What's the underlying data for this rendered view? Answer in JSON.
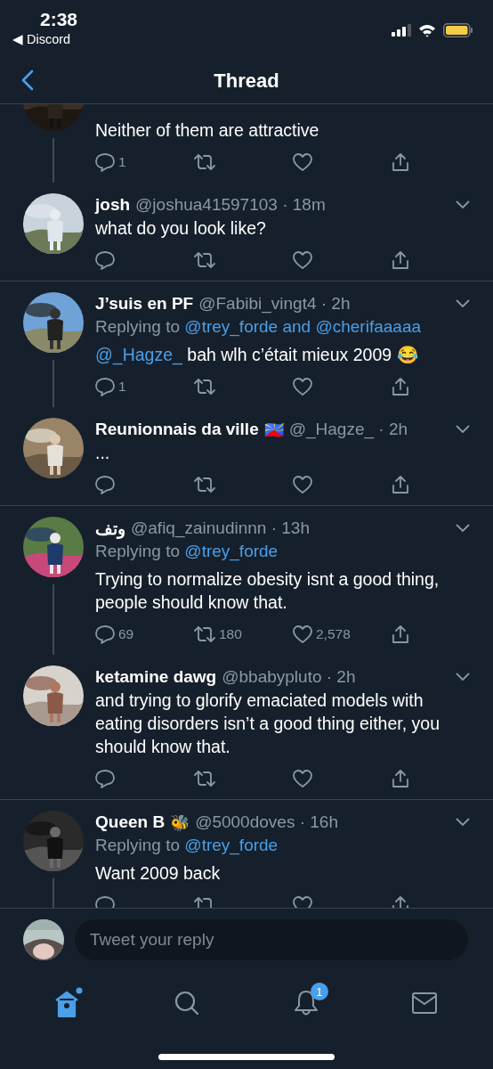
{
  "status_bar": {
    "time": "2:38",
    "back_app": "◀ Discord"
  },
  "header": {
    "title": "Thread"
  },
  "tweets": [
    {
      "text": "Neither of them are attractive",
      "replies": "1",
      "connected_below": true
    },
    {
      "name": "josh",
      "meta": "@joshua41597103 · 18m",
      "text": "what do you look like?",
      "connected_below": false
    },
    {
      "name": "J’suis en PF",
      "meta": "@Fabibi_vingt4 · 2h",
      "replying_label": "Replying to",
      "replying_to": "@trey_forde and @cherifaaaaa",
      "lead_mention": "@_Hagze_",
      "text": "bah wlh c’était mieux 2009",
      "emoji": "😂",
      "replies": "1",
      "connected_below": true
    },
    {
      "name": "Reunionnais da ville",
      "badge": "🇷🇪",
      "meta": "@_Hagze_ · 2h",
      "text": "...",
      "connected_below": false
    },
    {
      "name": "وتف",
      "meta": "@afiq_zainudinnn · 13h",
      "replying_label": "Replying to",
      "replying_to": "@trey_forde",
      "text": "Trying to normalize obesity isnt a good thing, people should know that.",
      "replies": "69",
      "retweets": "180",
      "likes": "2,578",
      "connected_below": true
    },
    {
      "name": "ketamine dawg",
      "meta": "@bbabypluto · 2h",
      "text": "and trying to glorify emaciated models with eating disorders isn’t a good thing either, you should know that.",
      "connected_below": false
    },
    {
      "name": "Queen B",
      "badge": "🐝",
      "meta": "@5000doves · 16h",
      "replying_label": "Replying to",
      "replying_to": "@trey_forde",
      "text": "Want 2009 back",
      "connected_below": true
    }
  ],
  "reply_bar": {
    "placeholder": "Tweet your reply"
  },
  "tab_bar": [
    {
      "kind": "home",
      "selected": true
    },
    {
      "kind": "search",
      "selected": false
    },
    {
      "kind": "notifications",
      "selected": false,
      "badge": "1"
    },
    {
      "kind": "messages",
      "selected": false
    }
  ]
}
